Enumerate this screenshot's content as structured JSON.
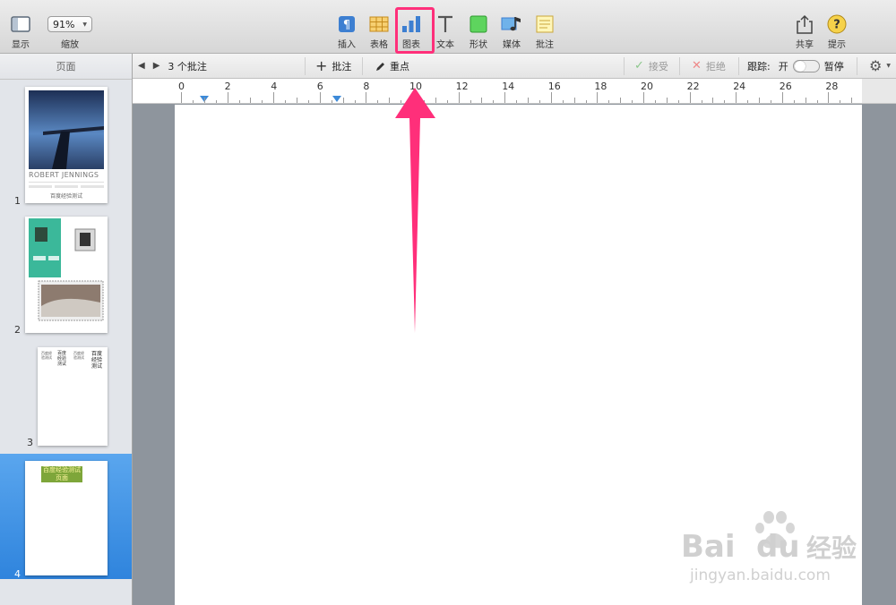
{
  "toolbar": {
    "view_label": "显示",
    "zoom_value": "91%",
    "zoom_label": "缩放",
    "insert_label": "插入",
    "table_label": "表格",
    "chart_label": "图表",
    "text_label": "文本",
    "shape_label": "形状",
    "media_label": "媒体",
    "comment_label": "批注",
    "share_label": "共享",
    "tips_label": "提示",
    "highlight_color": "#ff2f7a"
  },
  "sidebar": {
    "header": "页面",
    "pages": [
      {
        "number": "1",
        "title": "ROBERT JENNINGS",
        "caption": "百度经验测试"
      },
      {
        "number": "2"
      },
      {
        "number": "3",
        "col1": "百度经验测试",
        "col2": "百度经验测试",
        "col3": "百度经验测试",
        "col4": "百度经验测试"
      },
      {
        "number": "4",
        "banner": "百度经验测试页面"
      }
    ],
    "selected_page": "4"
  },
  "review_bar": {
    "comments_count": "3 个批注",
    "add_comment": "批注",
    "highlight": "重点",
    "accept": "接受",
    "reject": "拒绝",
    "tracking_label": "跟踪:",
    "tracking_state": "开",
    "pause": "暂停"
  },
  "ruler": {
    "labels": [
      "0",
      "2",
      "4",
      "6",
      "8",
      "10",
      "12",
      "14",
      "16",
      "18",
      "20",
      "22",
      "24",
      "26",
      "28"
    ]
  },
  "watermark": {
    "brand": "Bai",
    "brand2": "du",
    "cn": "经验",
    "url": "jingyan.baidu.com"
  }
}
